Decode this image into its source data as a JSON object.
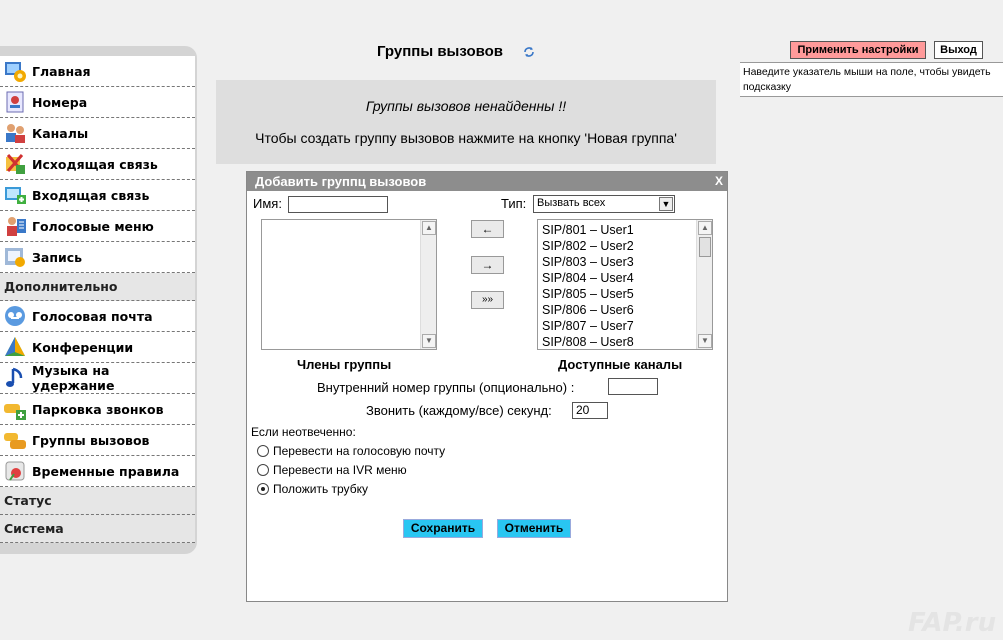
{
  "sidebar": {
    "items": [
      {
        "label": "Главная",
        "icon": "home-icon",
        "active": true
      },
      {
        "label": "Номера",
        "icon": "phone-book-icon"
      },
      {
        "label": "Каналы",
        "icon": "users-icon"
      },
      {
        "label": "Исходящая связь",
        "icon": "outgoing-call-icon"
      },
      {
        "label": "Входящая связь",
        "icon": "incoming-call-icon"
      },
      {
        "label": "Голосовые меню",
        "icon": "voice-menu-icon"
      },
      {
        "label": "Запись",
        "icon": "recording-icon"
      }
    ],
    "section_extra": "Дополнительно",
    "extra_items": [
      {
        "label": "Голосовая почта",
        "icon": "voicemail-icon"
      },
      {
        "label": "Конференции",
        "icon": "conference-icon"
      },
      {
        "label": "Музыка на удержание",
        "icon": "music-note-icon"
      },
      {
        "label": "Парковка звонков",
        "icon": "call-parking-icon"
      },
      {
        "label": "Группы вызовов",
        "icon": "ring-groups-icon"
      },
      {
        "label": "Временные правила",
        "icon": "time-rules-icon"
      }
    ],
    "section_status": "Статус",
    "section_system": "Система"
  },
  "header": {
    "title": "Группы вызовов",
    "refresh_icon": "refresh-icon"
  },
  "notice": {
    "line1": "Группы вызовов ненайденны !!",
    "line2": "Чтобы создать группу вызовов нажмите на кнопку 'Новая группа'"
  },
  "topright": {
    "apply_label": "Применить настройки",
    "exit_label": "Выход",
    "hint": "Наведите указатель мыши на поле, чтобы увидеть подсказку",
    "colors": {
      "apply_bg": "#ff9a9a"
    }
  },
  "dialog": {
    "title": "Добавить группц вызовов",
    "close_label": "X",
    "name_label": "Имя:",
    "name_value": "",
    "type_label": "Тип:",
    "type_selected": "Вызвать всех",
    "move_left_label": "←",
    "move_right_label": "→",
    "move_all_label": "»»",
    "members_label": "Члены группы",
    "available_label": "Доступные каналы",
    "channels": [
      "SIP/801 – User1",
      "SIP/802 – User2",
      "SIP/803 – User3",
      "SIP/804 – User4",
      "SIP/805 – User5",
      "SIP/806 – User6",
      "SIP/807 – User7",
      "SIP/808 – User8"
    ],
    "ext_label": "Внутренний номер группы (опционально) :",
    "ext_value": "",
    "ring_label": "Звонить (каждому/все) секунд:",
    "ring_value": "20",
    "no_answer_label": "Если неотвеченно:",
    "options": [
      {
        "label": "Перевести на голосовую почту",
        "checked": false
      },
      {
        "label": "Перевести на IVR меню",
        "checked": false
      },
      {
        "label": "Положить трубку",
        "checked": true
      }
    ],
    "save_label": "Сохранить",
    "cancel_label": "Отменить",
    "colors": {
      "button_bg": "#29c6f2",
      "titlebar_bg": "#8d8d8d"
    }
  },
  "watermark": "FAP.ru"
}
